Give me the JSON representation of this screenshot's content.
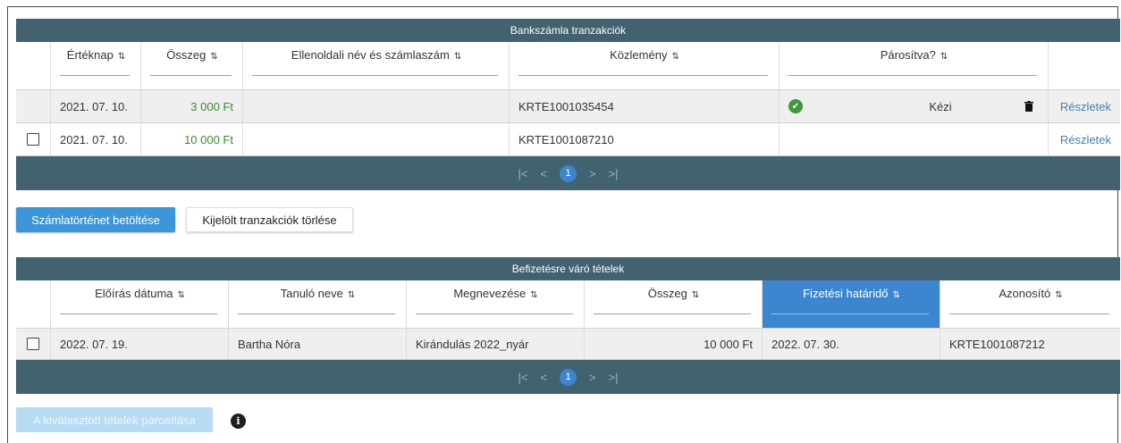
{
  "bank": {
    "title": "Bankszámla tranzakciók",
    "columns": [
      "Értéknap",
      "Összeg",
      "Ellenoldali név és számlaszám",
      "Közlemény",
      "Párosítva?"
    ],
    "rows": [
      {
        "date": "2021. 07. 10.",
        "amount": "3 000 Ft",
        "counterparty": "",
        "reference": "KRTE1001035454",
        "paired_label": "Kézi",
        "details": "Részletek"
      },
      {
        "date": "2021. 07. 10.",
        "amount": "10 000 Ft",
        "counterparty": "",
        "reference": "KRTE1001087210",
        "paired_label": "",
        "details": "Részletek"
      }
    ],
    "pager": {
      "first": "|<",
      "prev": "<",
      "page": "1",
      "next": ">",
      "last": ">|"
    }
  },
  "buttons": {
    "load_history": "Számlatörténet betöltése",
    "delete_selected": "Kijelölt tranzakciók törlése",
    "pair_selected": "A kiválasztott tételek párosítása"
  },
  "due": {
    "title": "Befizetésre váró tételek",
    "columns": [
      "Előírás dátuma",
      "Tanuló neve",
      "Megnevezése",
      "Összeg",
      "Fizetési határidő",
      "Azonosító"
    ],
    "active_column": "Fizetési határidő",
    "rows": [
      {
        "issue_date": "2022. 07. 19.",
        "student": "Bartha Nóra",
        "name": "Kirándulás 2022_nyár",
        "amount": "10 000 Ft",
        "deadline": "2022. 07. 30.",
        "id": "KRTE1001087212"
      }
    ],
    "pager": {
      "first": "|<",
      "prev": "<",
      "page": "1",
      "next": ">",
      "last": ">|"
    }
  },
  "icons": {
    "sort": "sort-icon",
    "sort_active": "sort-ascending-icon",
    "paired": "check-circle-icon",
    "delete": "trash-icon",
    "info": "info-icon"
  },
  "colors": {
    "header_bar": "#426270",
    "primary": "#3c96d8",
    "active_column": "#3c86cf",
    "amount": "#3c8a2e",
    "link": "#4a7faa"
  }
}
